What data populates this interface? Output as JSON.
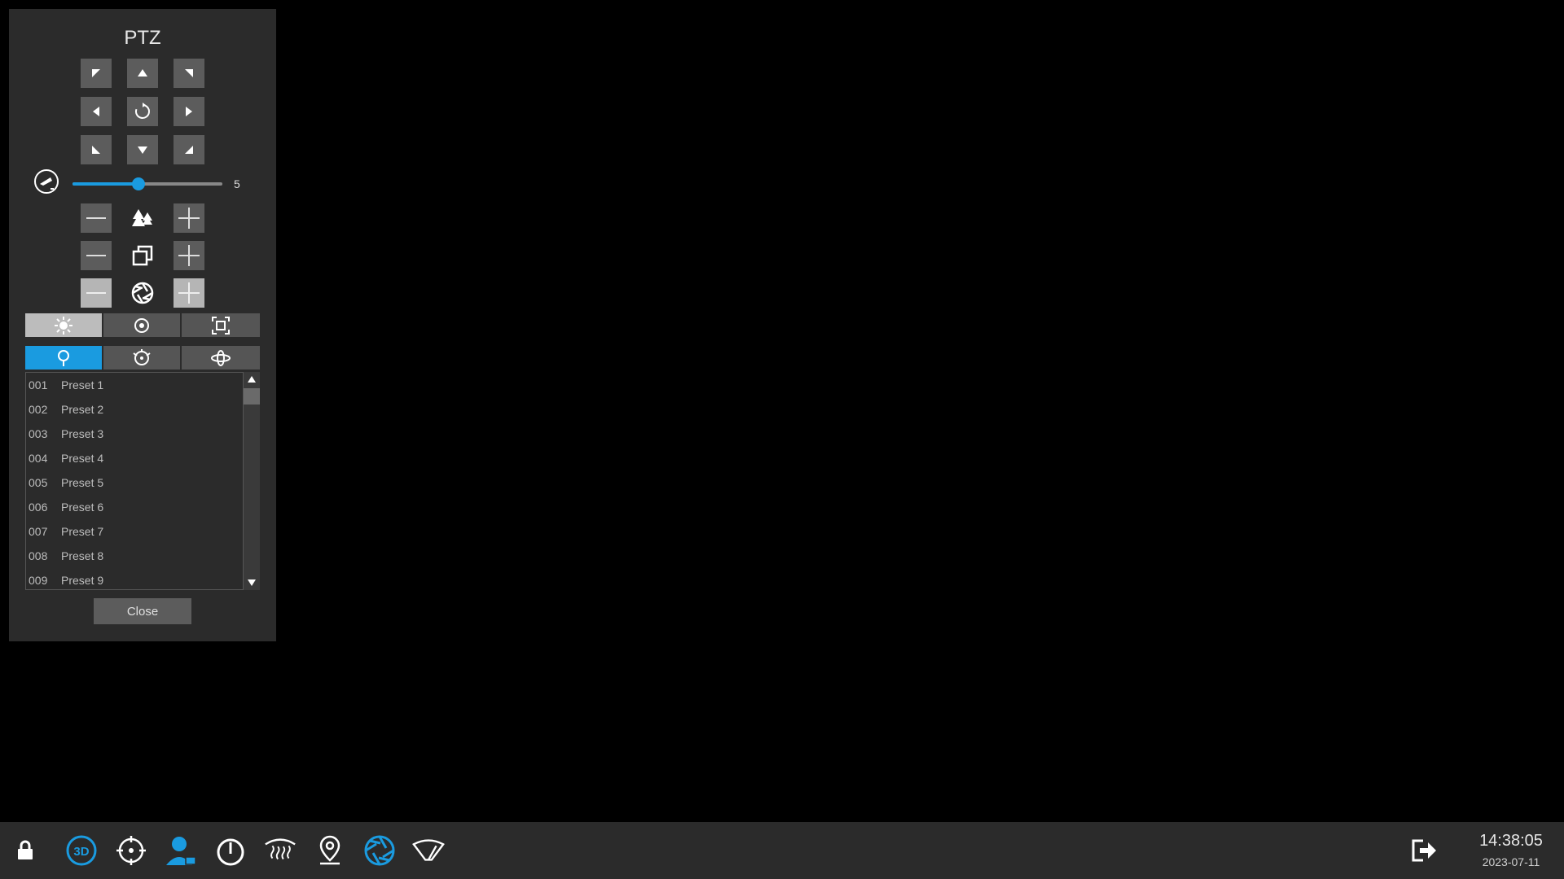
{
  "panel": {
    "title": "PTZ",
    "speed_value": "5",
    "speed_fraction": 0.44,
    "close_label": "Close"
  },
  "presets": [
    {
      "num": "001",
      "name": "Preset 1"
    },
    {
      "num": "002",
      "name": "Preset 2"
    },
    {
      "num": "003",
      "name": "Preset 3"
    },
    {
      "num": "004",
      "name": "Preset 4"
    },
    {
      "num": "005",
      "name": "Preset 5"
    },
    {
      "num": "006",
      "name": "Preset 6"
    },
    {
      "num": "007",
      "name": "Preset 7"
    },
    {
      "num": "008",
      "name": "Preset 8"
    },
    {
      "num": "009",
      "name": "Preset 9"
    }
  ],
  "taskbar": {
    "time": "14:38:05",
    "date": "2023-07-11"
  },
  "colors": {
    "accent": "#1a9be0"
  },
  "icons": [
    "lock-icon",
    "3d-icon",
    "crosshair-icon",
    "person-icon",
    "power-icon",
    "defog-icon",
    "location-pin-icon",
    "aperture-icon",
    "wiper-icon",
    "logout-icon"
  ]
}
